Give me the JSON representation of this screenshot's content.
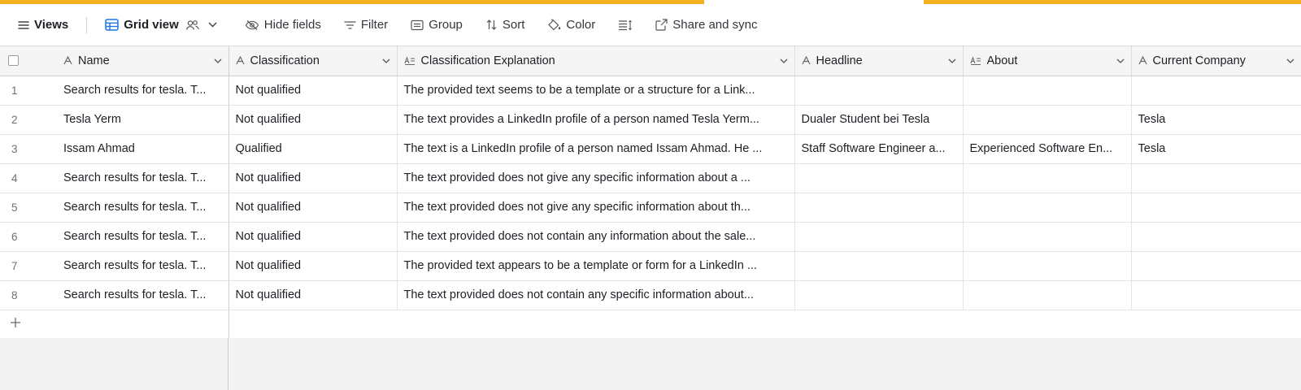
{
  "toolbar": {
    "views_label": "Views",
    "grid_view_label": "Grid view",
    "hide_fields_label": "Hide fields",
    "filter_label": "Filter",
    "group_label": "Group",
    "sort_label": "Sort",
    "color_label": "Color",
    "share_label": "Share and sync"
  },
  "columns": [
    {
      "label": "Name",
      "icon": "text-field-icon"
    },
    {
      "label": "Classification",
      "icon": "text-field-icon"
    },
    {
      "label": "Classification Explanation",
      "icon": "long-text-icon"
    },
    {
      "label": "Headline",
      "icon": "text-field-icon"
    },
    {
      "label": "About",
      "icon": "long-text-icon"
    },
    {
      "label": "Current Company",
      "icon": "text-field-icon"
    }
  ],
  "rows": [
    {
      "num": "1",
      "name": "Search results for tesla. T...",
      "classification": "Not qualified",
      "explanation": "The provided text seems to be a template or a structure for a Link...",
      "headline": "",
      "about": "",
      "company": ""
    },
    {
      "num": "2",
      "name": "Tesla Yerm",
      "classification": "Not qualified",
      "explanation": "The text provides a LinkedIn profile of a person named Tesla Yerm...",
      "headline": "Dualer Student bei Tesla",
      "about": "",
      "company": "Tesla"
    },
    {
      "num": "3",
      "name": "Issam Ahmad",
      "classification": "Qualified",
      "explanation": "The text is a LinkedIn profile of a person named Issam Ahmad. He ...",
      "headline": "Staff Software Engineer a...",
      "about": "Experienced Software En...",
      "company": "Tesla"
    },
    {
      "num": "4",
      "name": "Search results for tesla. T...",
      "classification": "Not qualified",
      "explanation": "The text provided does not give any specific information about a ...",
      "headline": "",
      "about": "",
      "company": ""
    },
    {
      "num": "5",
      "name": "Search results for tesla. T...",
      "classification": "Not qualified",
      "explanation": "The text provided does not give any specific information about th...",
      "headline": "",
      "about": "",
      "company": ""
    },
    {
      "num": "6",
      "name": "Search results for tesla. T...",
      "classification": "Not qualified",
      "explanation": "The text provided does not contain any information about the sale...",
      "headline": "",
      "about": "",
      "company": ""
    },
    {
      "num": "7",
      "name": "Search results for tesla. T...",
      "classification": "Not qualified",
      "explanation": "The provided text appears to be a template or form for a LinkedIn ...",
      "headline": "",
      "about": "",
      "company": ""
    },
    {
      "num": "8",
      "name": "Search results for tesla. T...",
      "classification": "Not qualified",
      "explanation": "The text provided does not contain any specific information about...",
      "headline": "",
      "about": "",
      "company": ""
    }
  ],
  "add_row_symbol": "+",
  "colors": {
    "accent": "#f2b21f",
    "grid_icon": "#1a73e8"
  }
}
